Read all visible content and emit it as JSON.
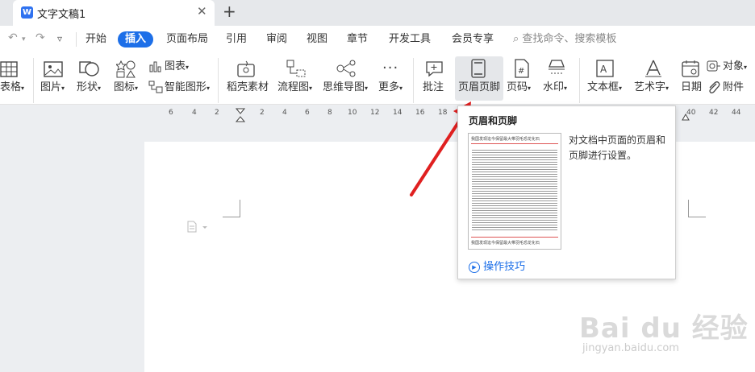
{
  "window": {
    "doc_tab_title": "文字文稿1",
    "app_icon_letter": "W"
  },
  "menu": {
    "items": [
      "开始",
      "插入",
      "页面布局",
      "引用",
      "审阅",
      "视图",
      "章节",
      "开发工具",
      "会员专享"
    ],
    "active": "插入",
    "search_placeholder": "查找命令、搜索模板"
  },
  "ribbon": {
    "table": "表格",
    "picture": "图片",
    "shape": "形状",
    "icon": "图标",
    "chart": "图表",
    "smart_graphic": "智能图形",
    "shell_material": "稻壳素材",
    "flowchart": "流程图",
    "mindmap": "思维导图",
    "more": "更多",
    "comment": "批注",
    "header_footer": "页眉页脚",
    "page_number": "页码",
    "watermark": "水印",
    "textbox": "文本框",
    "wordart": "艺术字",
    "date": "日期",
    "object": "对象",
    "attachment": "附件"
  },
  "ruler": {
    "ticks": [
      "6",
      "4",
      "2",
      "2",
      "4",
      "6",
      "8",
      "10",
      "12",
      "14",
      "16",
      "18",
      "40",
      "42",
      "44"
    ]
  },
  "tooltip": {
    "title": "页眉和页脚",
    "description": "对文档中页面的页眉和页脚进行设置。",
    "help_link": "操作技巧",
    "thumb_header_text": "我国发现迄今保留最大带羽毛恐龙化石",
    "thumb_footer_text": "我国发现迄今保留最大带羽毛恐龙化石"
  },
  "watermark": {
    "brand": "Bai du 经验",
    "url": "jingyan.baidu.com"
  },
  "colors": {
    "accent": "#1d6fe8",
    "arrow": "#e02020"
  }
}
